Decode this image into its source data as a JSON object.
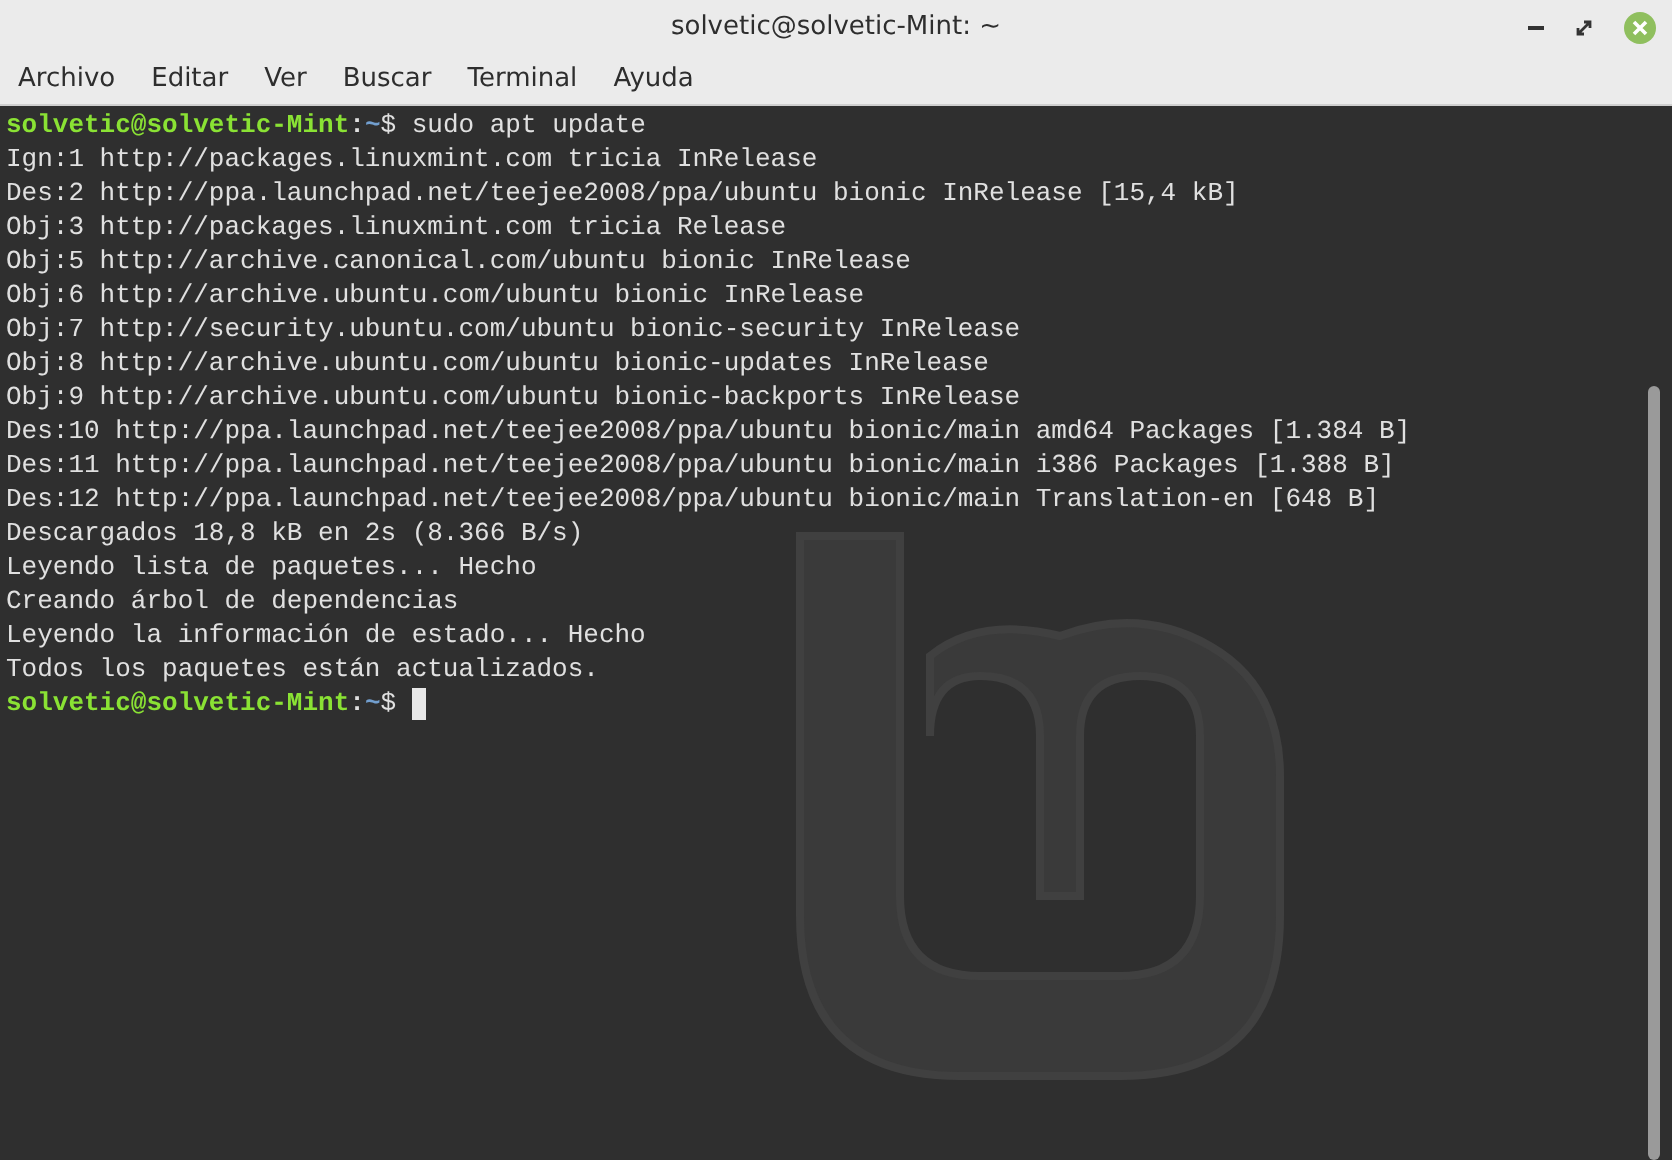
{
  "window": {
    "title": "solvetic@solvetic-Mint: ~"
  },
  "menu": [
    "Archivo",
    "Editar",
    "Ver",
    "Buscar",
    "Terminal",
    "Ayuda"
  ],
  "terminal": {
    "lines": [
      {
        "kind": "prompt",
        "user": "solvetic@solvetic-Mint",
        "sep": ":",
        "path": "~",
        "symbol": "$",
        "command": " sudo apt update"
      },
      {
        "kind": "output",
        "text": "Ign:1 http://packages.linuxmint.com tricia InRelease"
      },
      {
        "kind": "output",
        "text": "Des:2 http://ppa.launchpad.net/teejee2008/ppa/ubuntu bionic InRelease [15,4 kB]"
      },
      {
        "kind": "output",
        "text": "Obj:3 http://packages.linuxmint.com tricia Release"
      },
      {
        "kind": "output",
        "text": "Obj:5 http://archive.canonical.com/ubuntu bionic InRelease"
      },
      {
        "kind": "output",
        "text": "Obj:6 http://archive.ubuntu.com/ubuntu bionic InRelease"
      },
      {
        "kind": "output",
        "text": "Obj:7 http://security.ubuntu.com/ubuntu bionic-security InRelease"
      },
      {
        "kind": "output",
        "text": "Obj:8 http://archive.ubuntu.com/ubuntu bionic-updates InRelease"
      },
      {
        "kind": "output",
        "text": "Obj:9 http://archive.ubuntu.com/ubuntu bionic-backports InRelease"
      },
      {
        "kind": "output",
        "text": "Des:10 http://ppa.launchpad.net/teejee2008/ppa/ubuntu bionic/main amd64 Packages [1.384 B]"
      },
      {
        "kind": "output",
        "text": "Des:11 http://ppa.launchpad.net/teejee2008/ppa/ubuntu bionic/main i386 Packages [1.388 B]"
      },
      {
        "kind": "output",
        "text": "Des:12 http://ppa.launchpad.net/teejee2008/ppa/ubuntu bionic/main Translation-en [648 B]"
      },
      {
        "kind": "output",
        "text": "Descargados 18,8 kB en 2s (8.366 B/s)"
      },
      {
        "kind": "output",
        "text": "Leyendo lista de paquetes... Hecho"
      },
      {
        "kind": "output",
        "text": "Creando árbol de dependencias"
      },
      {
        "kind": "output",
        "text": "Leyendo la información de estado... Hecho"
      },
      {
        "kind": "output",
        "text": "Todos los paquetes están actualizados."
      },
      {
        "kind": "prompt",
        "user": "solvetic@solvetic-Mint",
        "sep": ":",
        "path": "~",
        "symbol": "$",
        "cursor": true
      }
    ]
  }
}
